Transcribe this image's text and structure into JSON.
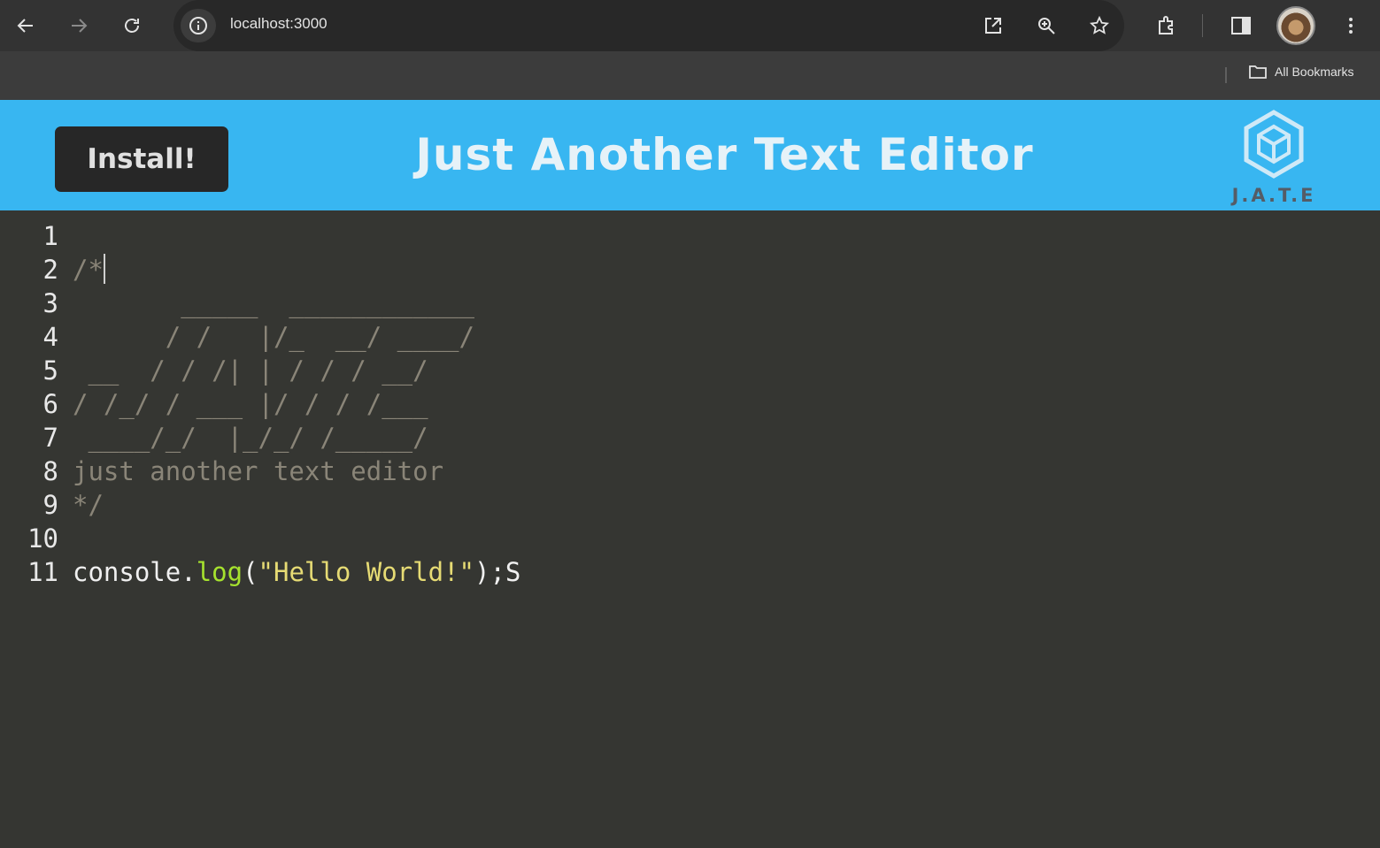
{
  "browser": {
    "url": "localhost:3000",
    "bookmarks_label": "All Bookmarks"
  },
  "app": {
    "install_label": "Install!",
    "title": "Just Another Text Editor",
    "logo_text": "J.A.T.E"
  },
  "editor": {
    "line_numbers": [
      "1",
      "2",
      "3",
      "4",
      "5",
      "6",
      "7",
      "8",
      "9",
      "10",
      "11"
    ],
    "lines": [
      "",
      "/*",
      "       _____  ____________",
      "      / /   |/_  __/ ____/",
      " __  / / /| | / / / __/",
      "/ /_/ / ___ |/ / / /___",
      " ____/_/  |_/_/ /_____/",
      "just another text editor",
      "*/",
      "",
      ""
    ],
    "code_line": {
      "obj": "console.",
      "fn": "log",
      "open": "(",
      "str": "\"Hello World!\"",
      "close": ");S"
    }
  },
  "colors": {
    "header": "#38b6f1",
    "editor_bg": "#353632",
    "comment": "#8a8578",
    "function": "#a6e22e",
    "string": "#e6db74"
  }
}
